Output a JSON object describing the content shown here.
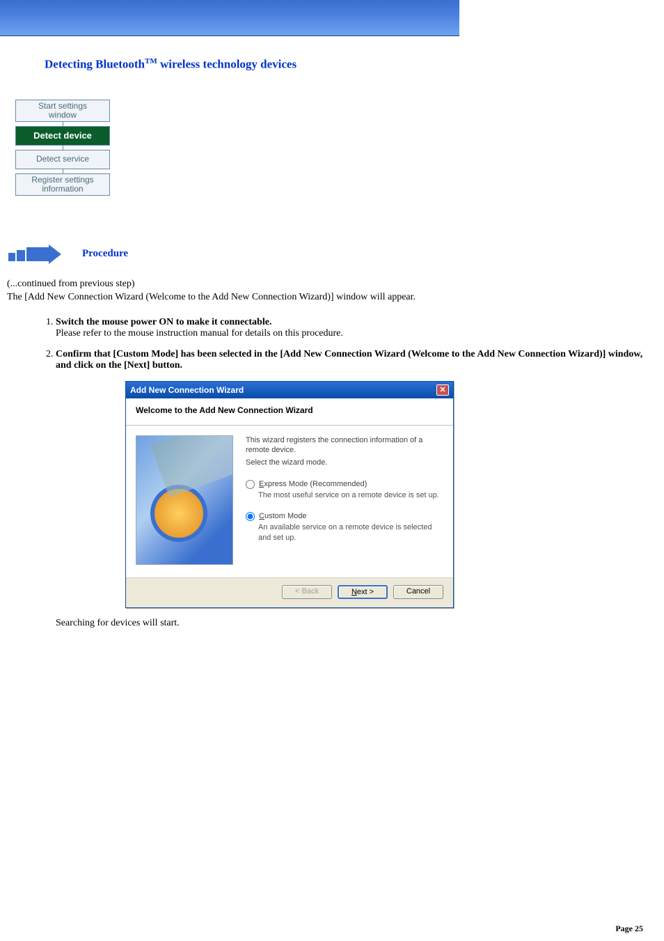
{
  "page": {
    "title_prefix": "Detecting Bluetooth",
    "title_suffix": " wireless technology devices",
    "footer_label": "Page  25"
  },
  "flow": {
    "box1": "Start settings\nwindow",
    "box2": "Detect device",
    "box3": "Detect service",
    "box4": "Register settings\ninformation"
  },
  "procedure": {
    "label": "Procedure"
  },
  "intro": {
    "line1": "(...continued from previous step)",
    "line2": "The [Add New Connection Wizard (Welcome to the Add New Connection Wizard)] window will appear."
  },
  "steps": [
    {
      "heading": "Switch the mouse power ON to make it connectable.",
      "body": "Please refer to the mouse instruction manual for details on this procedure."
    },
    {
      "heading": "Confirm that [Custom Mode] has been selected in the [Add New Connection Wizard (Welcome to the Add New Connection Wizard)] window, and click on the [Next] button.",
      "body": ""
    }
  ],
  "dialog": {
    "titlebar": "Add New Connection Wizard",
    "header": "Welcome to the Add New Connection Wizard",
    "intro1": "This wizard registers the connection information of a remote device.",
    "intro2": "Select the wizard mode.",
    "opt1": {
      "accel": "E",
      "rest": "xpress Mode (Recommended)",
      "desc": "The most useful service on a remote device is set up."
    },
    "opt2": {
      "accel": "C",
      "rest": "ustom Mode",
      "desc": "An available service on a remote device is selected and set up."
    },
    "btn_back": "< Back",
    "btn_next": "Next >",
    "btn_cancel": "Cancel"
  },
  "after": "Searching for devices will start."
}
